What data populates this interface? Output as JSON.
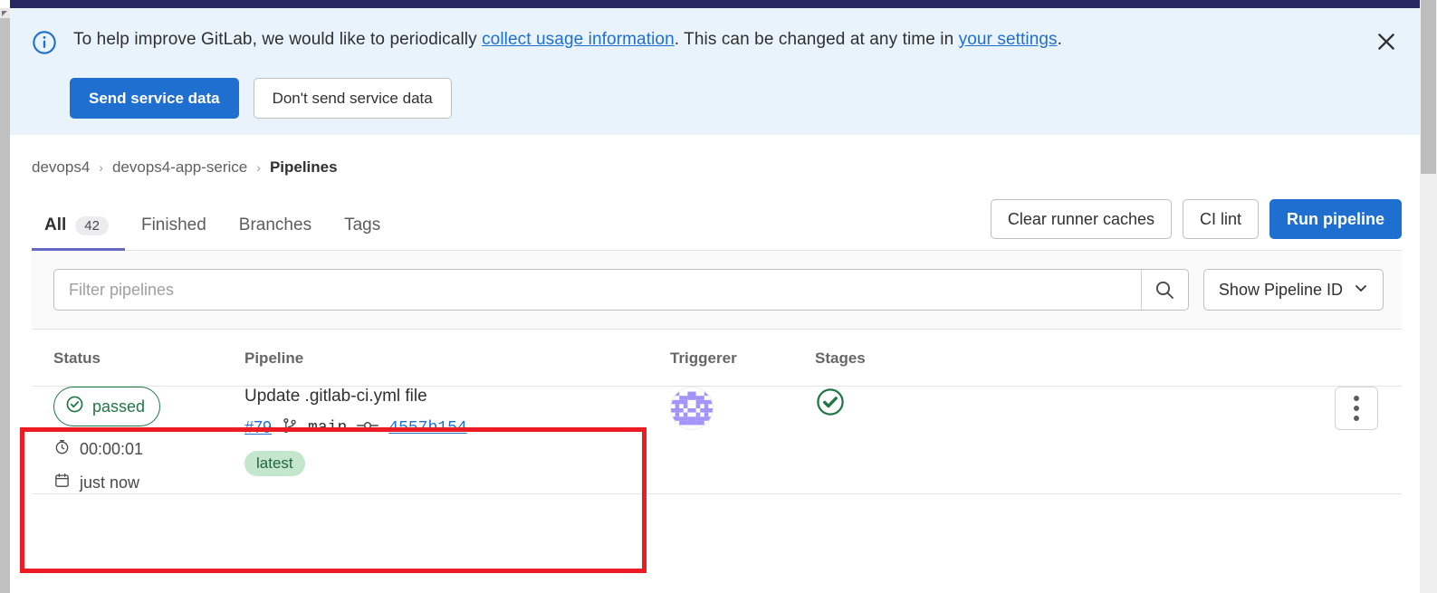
{
  "window": {
    "top_bar_color": "#292961",
    "accent_blue": "#1f6fd0",
    "highlight_color": "#ed1c24"
  },
  "banner": {
    "icon": "info-circle-icon",
    "text_before_link1": "To help improve GitLab, we would like to periodically ",
    "link1": "collect usage information",
    "text_between": ". This can be changed at any time in ",
    "link2": "your settings",
    "text_after": ".",
    "primary_button": "Send service data",
    "secondary_button": "Don't send service data",
    "close_icon": "close-icon"
  },
  "breadcrumb": {
    "items": [
      {
        "label": "devops4",
        "current": false
      },
      {
        "label": "devops4-app-serice",
        "current": false
      },
      {
        "label": "Pipelines",
        "current": true
      }
    ],
    "separator": "›"
  },
  "tabs": [
    {
      "label": "All",
      "count": "42",
      "active": true
    },
    {
      "label": "Finished",
      "count": null,
      "active": false
    },
    {
      "label": "Branches",
      "count": null,
      "active": false
    },
    {
      "label": "Tags",
      "count": null,
      "active": false
    }
  ],
  "toolbar": {
    "clear_caches_label": "Clear runner caches",
    "ci_lint_label": "CI lint",
    "run_pipeline_label": "Run pipeline"
  },
  "filter": {
    "placeholder": "Filter pipelines",
    "value": "",
    "search_icon": "search-icon",
    "dropdown_label": "Show Pipeline ID",
    "dropdown_icon": "chevron-down-icon"
  },
  "table": {
    "headers": {
      "status": "Status",
      "pipeline": "Pipeline",
      "triggerer": "Triggerer",
      "stages": "Stages",
      "actions": ""
    },
    "rows": [
      {
        "status": {
          "label": "passed",
          "icon": "status-passed-icon",
          "color": "#217645",
          "duration_icon": "timer-icon",
          "duration": "00:00:01",
          "date_icon": "calendar-icon",
          "date": "just now"
        },
        "pipeline": {
          "title": "Update .gitlab-ci.yml file",
          "id": "#79",
          "branch_icon": "branch-icon",
          "branch": "main",
          "commit_icon": "commit-icon",
          "commit": "4557b154",
          "badge": "latest"
        },
        "triggerer": {
          "avatar": "identicon-avatar",
          "avatar_color": "#a294f9"
        },
        "stages": [
          {
            "icon": "status-passed-icon",
            "color": "#217645"
          }
        ],
        "actions": {
          "icon": "kebab-menu-icon"
        },
        "highlighted": true
      }
    ]
  }
}
